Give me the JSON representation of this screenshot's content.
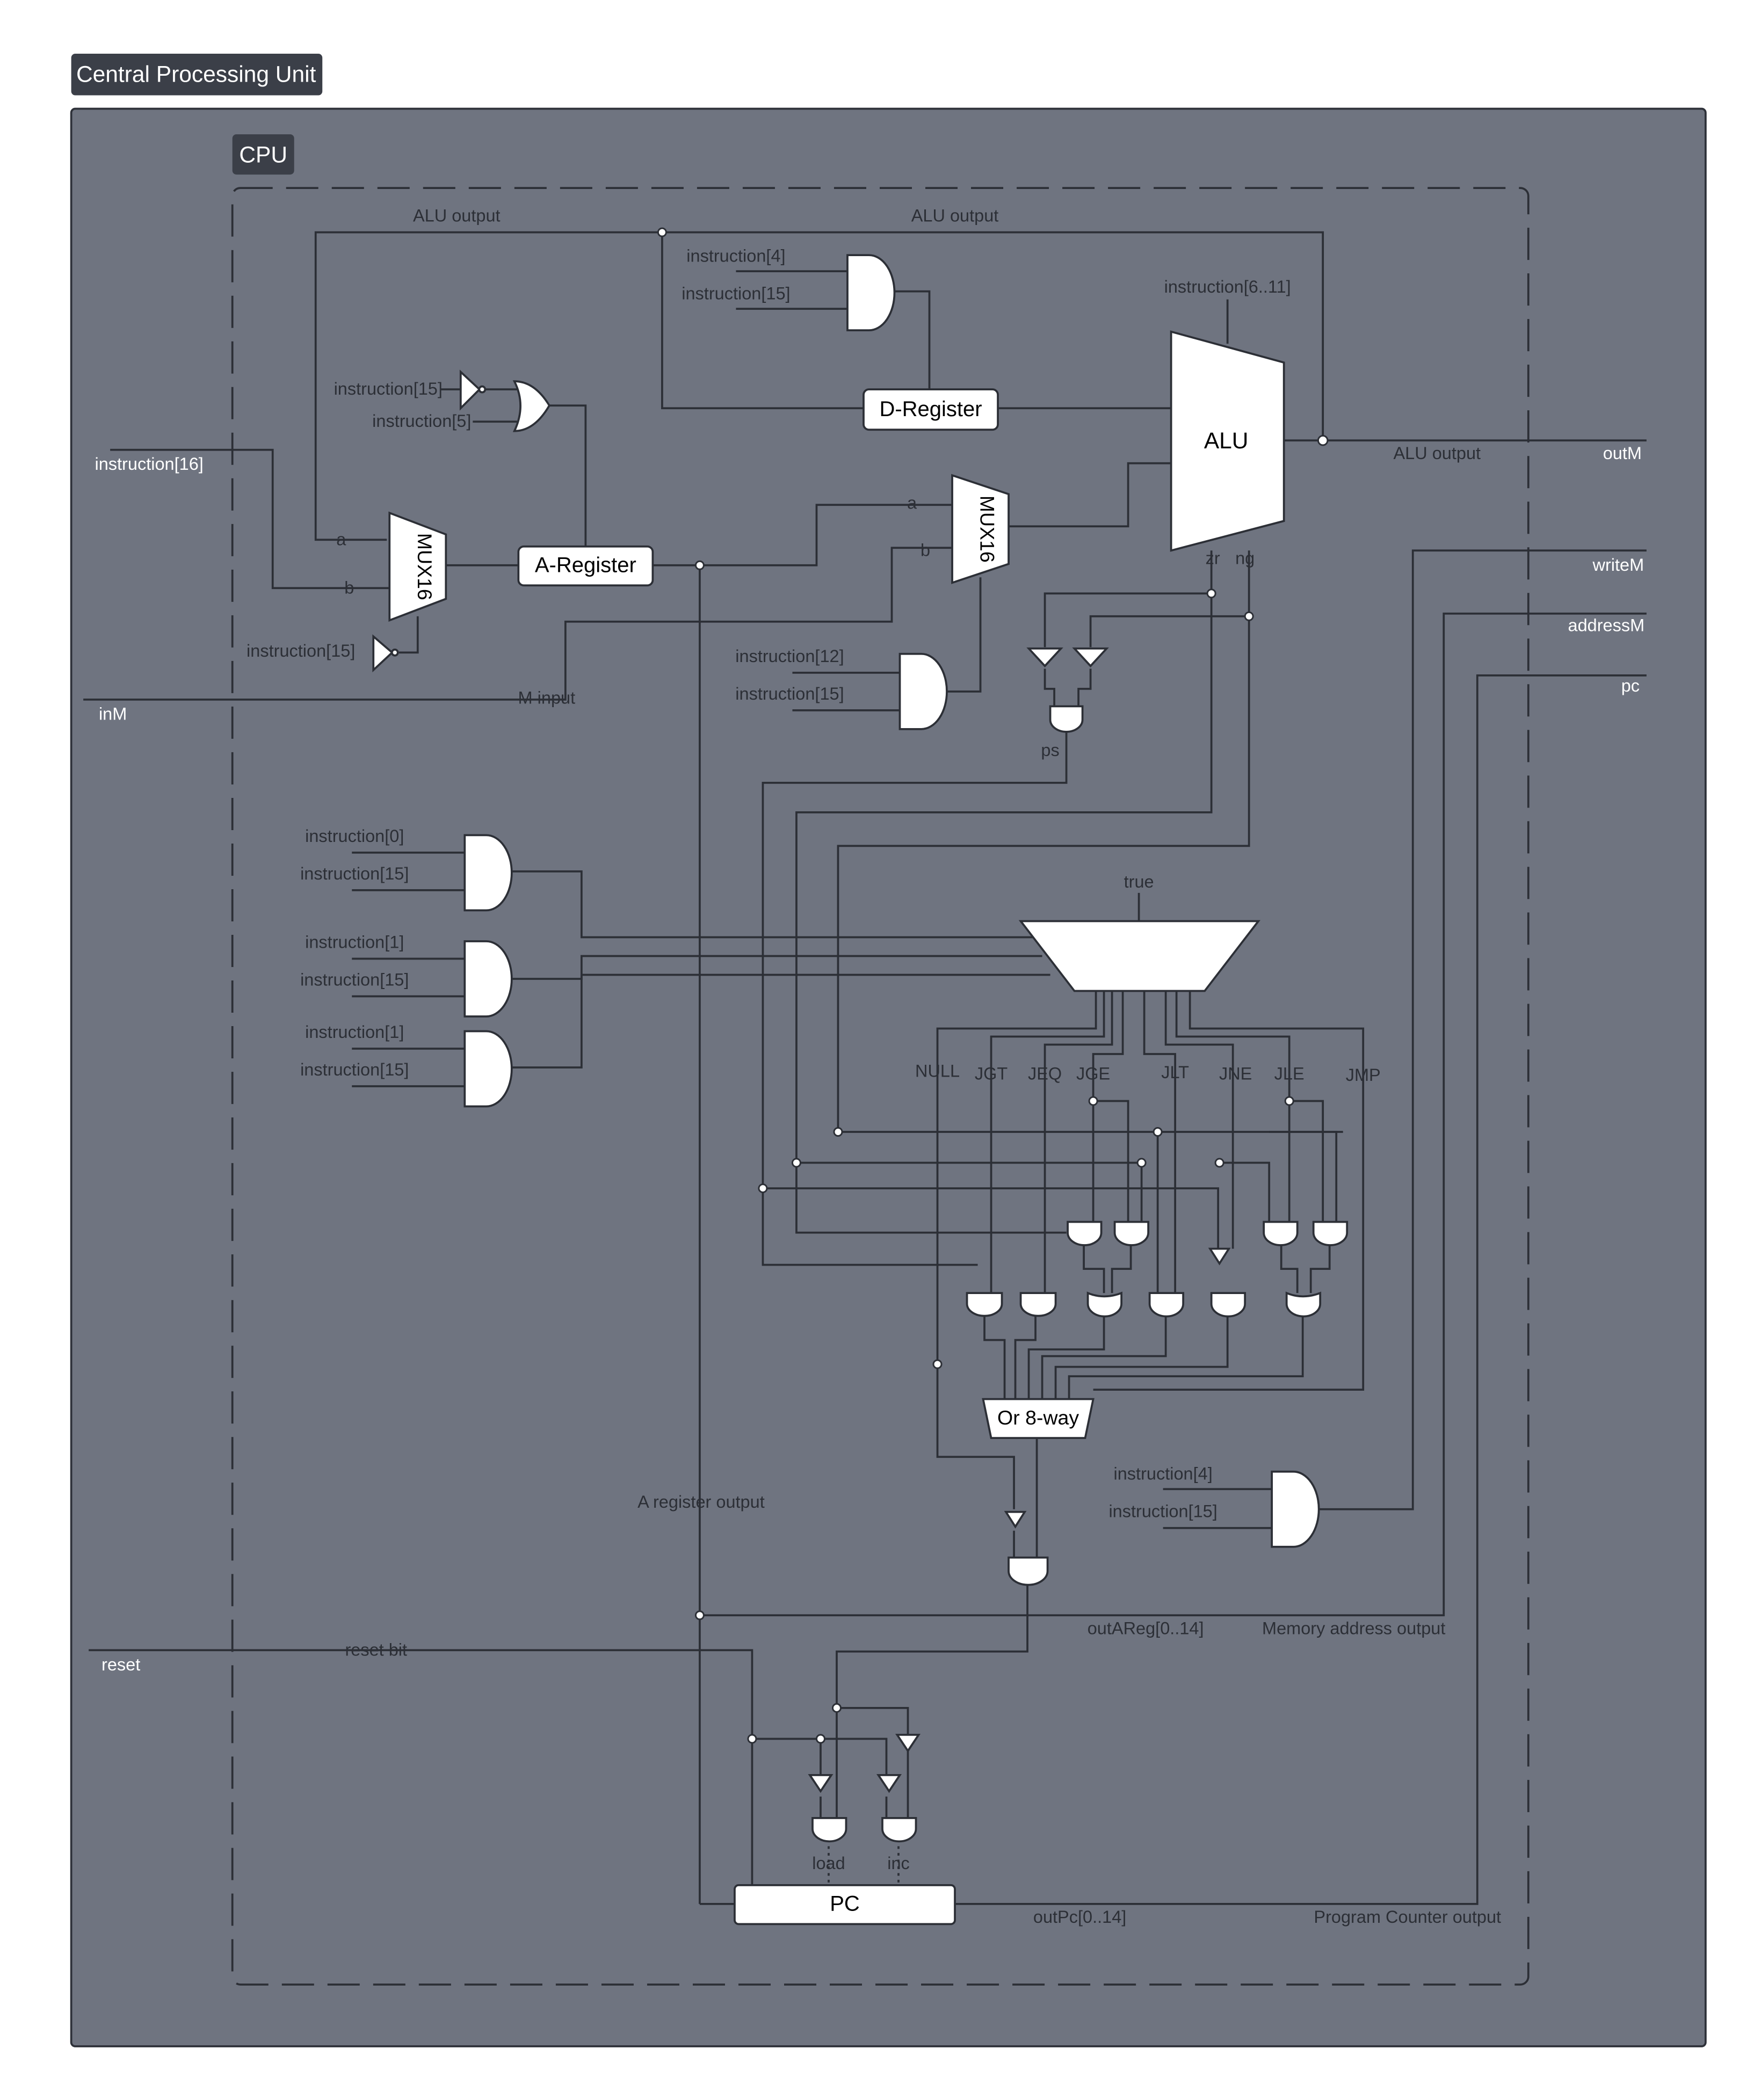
{
  "title": "Central Processing Unit",
  "frame_label": "CPU",
  "components": {
    "alu": "ALU",
    "a_register": "A-Register",
    "d_register": "D-Register",
    "mux_a": "MUX16",
    "mux_b": "MUX16",
    "or8": "Or 8-way",
    "pc": "PC"
  },
  "external": {
    "instruction_in": "instruction[16]",
    "inM": "inM",
    "reset": "reset",
    "outM": "outM",
    "writeM": "writeM",
    "addressM": "addressM",
    "pc_out": "pc"
  },
  "wire_labels": {
    "alu_output_1": "ALU output",
    "alu_output_2": "ALU output",
    "alu_output_3": "ALU output",
    "m_input": "M input",
    "a_register_output": "A register output",
    "reset_bit": "reset bit",
    "out_areg": "outAReg[0..14]",
    "memory_address_output": "Memory address output",
    "out_pc": "outPc[0..14]",
    "program_counter_output": "Program Counter output",
    "zr": "zr",
    "ng": "ng",
    "ps": "ps",
    "true": "true",
    "load": "load",
    "inc": "inc",
    "mux_in_a1": "a",
    "mux_in_b1": "b",
    "mux_in_a2": "a",
    "mux_in_b2": "b"
  },
  "gate_inputs": {
    "d_and_1": "instruction[4]",
    "d_and_2": "instruction[15]",
    "a_or_1": "instruction[15]",
    "a_or_2": "instruction[5]",
    "mux_sel": "instruction[15]",
    "alu_ctrl": "instruction[6..11]",
    "m_and_1": "instruction[12]",
    "m_and_2": "instruction[15]",
    "j0_1": "instruction[0]",
    "j0_2": "instruction[15]",
    "j1_1": "instruction[1]",
    "j1_2": "instruction[15]",
    "j2_1": "instruction[1]",
    "j2_2": "instruction[15]",
    "w_and_1": "instruction[4]",
    "w_and_2": "instruction[15]"
  },
  "jumps": [
    "NULL",
    "JGT",
    "JEQ",
    "JGE",
    "JLT",
    "JNE",
    "JLE",
    "JMP"
  ],
  "colors": {
    "panel": "#6f7480",
    "panel_border": "#2e3139",
    "wire": "#2c2f36",
    "component": "#ffffff",
    "title_bg": "#3b3f48",
    "label_dark": "#2c2f36",
    "label_light": "#ffffff"
  }
}
